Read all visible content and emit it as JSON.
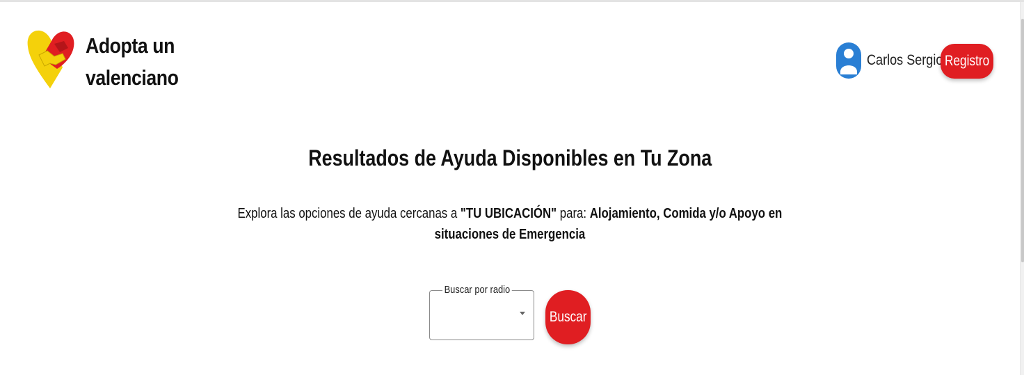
{
  "header": {
    "brand_line1": "Adopta un",
    "brand_line2": "valenciano",
    "logo_icon": "heart-handshake-icon",
    "user_name": "Carlos Sergio",
    "avatar_icon": "user-avatar-icon",
    "register_label": "Registro"
  },
  "main": {
    "title": "Resultados de Ayuda Disponibles en Tu Zona",
    "subtitle": {
      "text1": "Explora las opciones de ayuda cercanas a ",
      "location": "\"TU UBICACIÓN\"",
      "text2": " para: ",
      "bold1": "Alojamiento, Comida y/o Apoyo en",
      "bold2": "situaciones de Emergencia"
    },
    "radius_select": {
      "label": "Buscar por radio",
      "value": ""
    },
    "search_label": "Buscar"
  },
  "colors": {
    "accent_red": "#e01e22",
    "logo_yellow": "#f4d10b",
    "avatar_blue": "#2a7fd4"
  }
}
